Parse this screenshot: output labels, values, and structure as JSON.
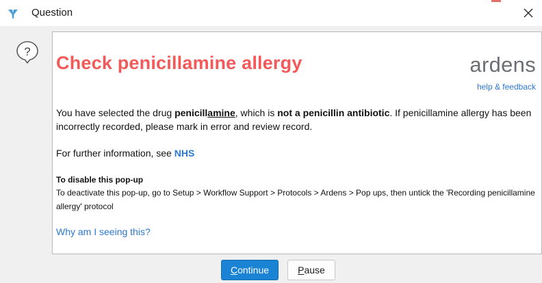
{
  "window": {
    "title": "Question",
    "close_glyph": "✕",
    "app_icon": "ardens-app-icon",
    "question_icon": "question-speech-bubble-icon"
  },
  "content": {
    "heading": "Check penicillamine allergy",
    "brand": "ardens",
    "help_link": "help & feedback",
    "message": {
      "intro": "You have selected the drug ",
      "drug_part1": "penicill",
      "drug_part2": "amine",
      "mid": ", which is ",
      "emphasis": "not a penicillin antibiotic",
      "rest": ". If penicillamine allergy has been incorrectly recorded, please mark in error and review record."
    },
    "further_info_prefix": "For further information, see ",
    "nhs_link": "NHS",
    "disable_title": "To disable this pop-up",
    "disable_body": "To deactivate this pop-up, go to Setup > Workflow Support > Protocols > Ardens > Pop ups, then untick the 'Recording penicillamine allergy' protocol",
    "why_link": "Why am I seeing this?"
  },
  "buttons": {
    "continue_mnemonic": "C",
    "continue_rest": "ontinue",
    "pause_mnemonic": "P",
    "pause_rest": "ause"
  },
  "colors": {
    "heading": "#f25a5a",
    "link": "#2c77d0",
    "primary_button": "#1a83d3",
    "brand": "#6b6f75"
  }
}
